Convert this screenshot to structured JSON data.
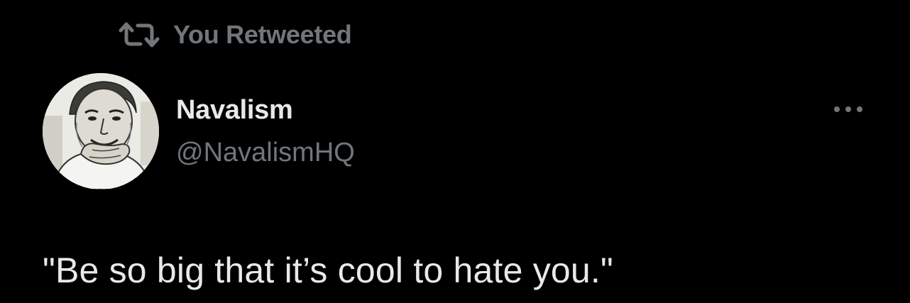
{
  "retweet": {
    "icon": "retweet-icon",
    "label": "You Retweeted"
  },
  "author": {
    "display_name": "Navalism",
    "handle": "@NavalismHQ",
    "avatar": "sketch-portrait-avatar"
  },
  "menu": {
    "icon": "more-options-icon"
  },
  "tweet": {
    "text": "\"Be so big that it’s cool to hate you.\""
  },
  "colors": {
    "background": "#000000",
    "primary_text": "#e7e9ea",
    "secondary_text": "#71767b"
  }
}
